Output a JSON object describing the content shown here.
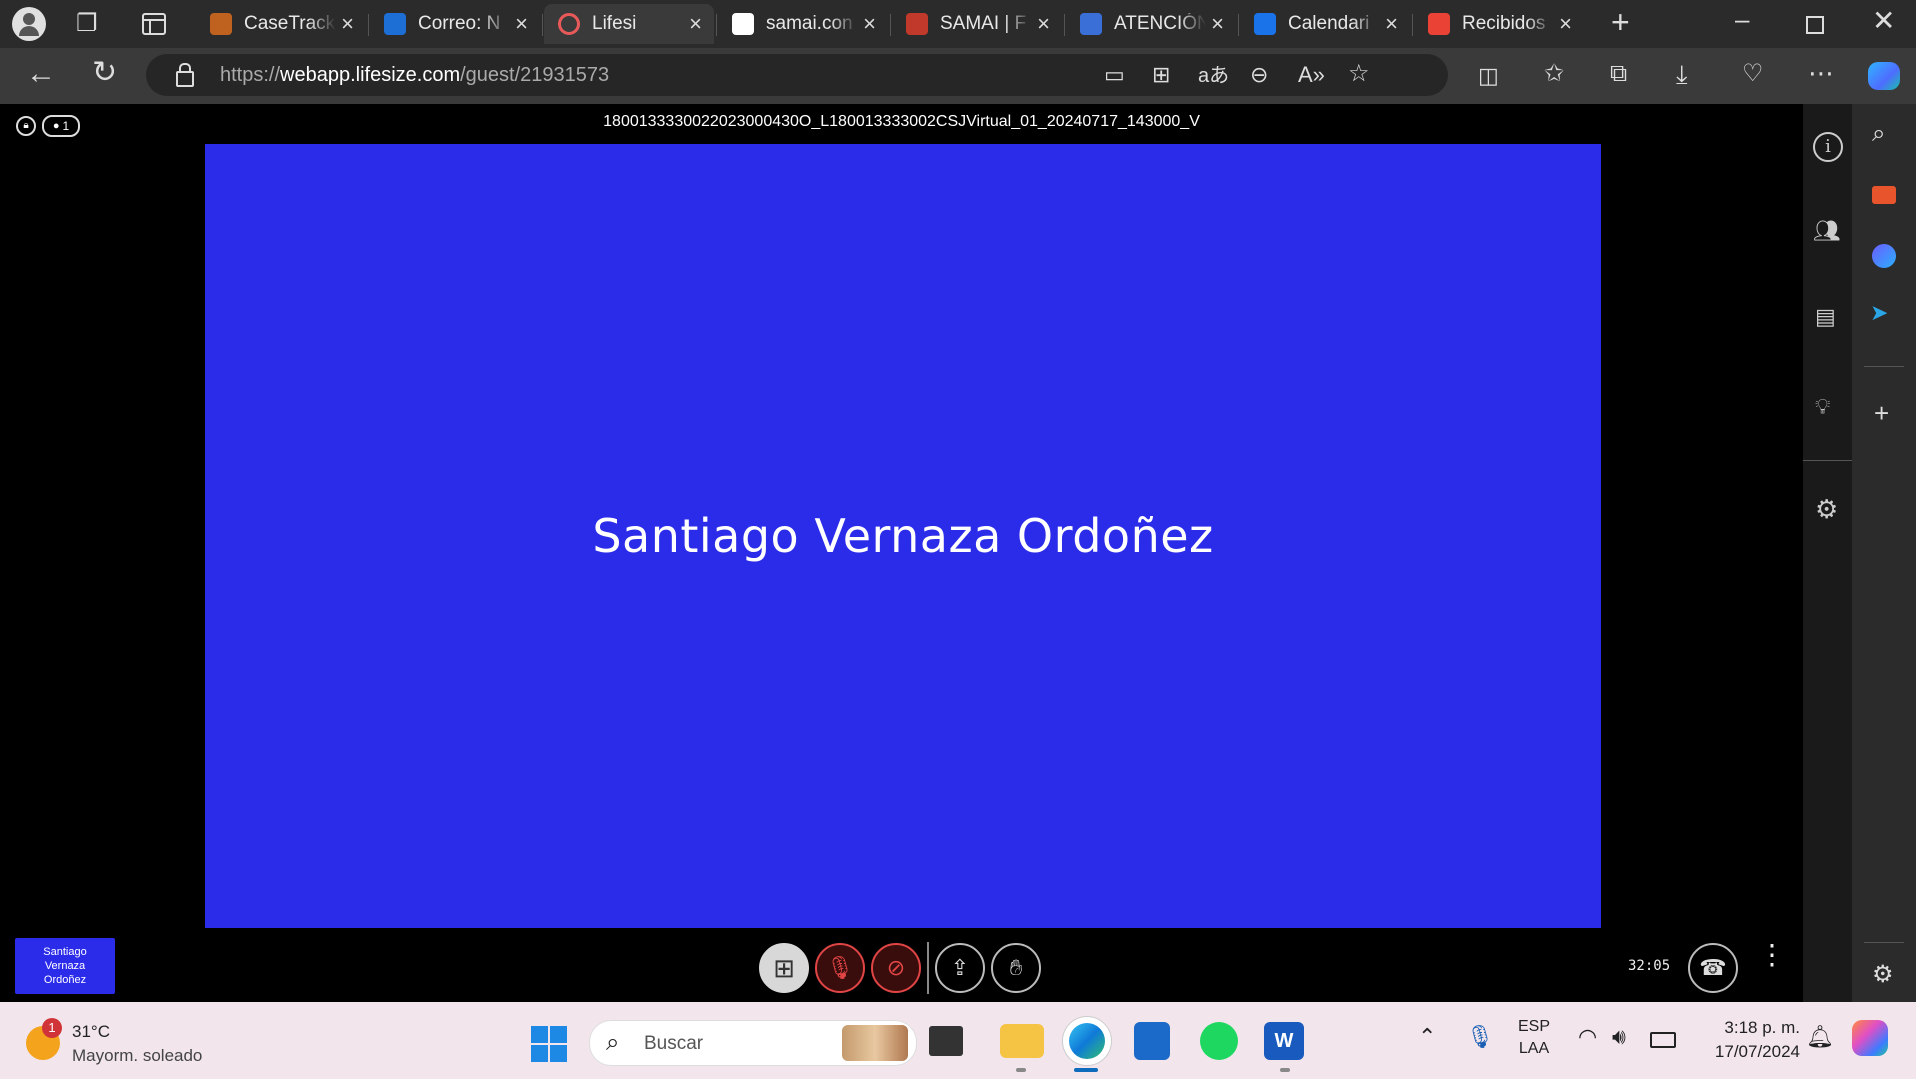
{
  "browser": {
    "tabs": [
      {
        "title": "CaseTrack",
        "icon": "casetrack-icon",
        "color": "#c0621f",
        "active": false
      },
      {
        "title": "Correo: N",
        "icon": "outlook-icon",
        "color": "#1d6fd6",
        "active": false
      },
      {
        "title": "Lifesi",
        "icon": "lifesize-icon",
        "color": "#e85a5a",
        "active": true
      },
      {
        "title": "samai.con",
        "icon": "document-icon",
        "color": "#ffffff",
        "active": false
      },
      {
        "title": "SAMAI | F",
        "icon": "samai-icon",
        "color": "#c0392b",
        "active": false
      },
      {
        "title": "ATENCIÓN",
        "icon": "grid-app-icon",
        "color": "#3a6fd8",
        "active": false
      },
      {
        "title": "Calendari",
        "icon": "calendar-icon",
        "color": "#1a73e8",
        "active": false
      },
      {
        "title": "Recibidos",
        "icon": "gmail-icon",
        "color": "#ea4335",
        "active": false
      }
    ],
    "url_prefix": "https://",
    "url_domain": "webapp.lifesize.com",
    "url_path": "/guest/21931573"
  },
  "meeting": {
    "title": "1800133330022023000430O_L180013333002CSJVirtual_01_20240717_143000_V",
    "participant_count": "1",
    "speaker_name": "Santiago Vernaza Ordoñez",
    "self_view_name": "Santiago Vernaza Ordoñez",
    "timer": "32:05",
    "accent_color": "#2b2bea"
  },
  "taskbar": {
    "weather_temp": "31°C",
    "weather_desc": "Mayorm. soleado",
    "weather_badge": "1",
    "search_placeholder": "Buscar",
    "lang_line1": "ESP",
    "lang_line2": "LAA",
    "time": "3:18 p. m.",
    "date": "17/07/2024"
  }
}
